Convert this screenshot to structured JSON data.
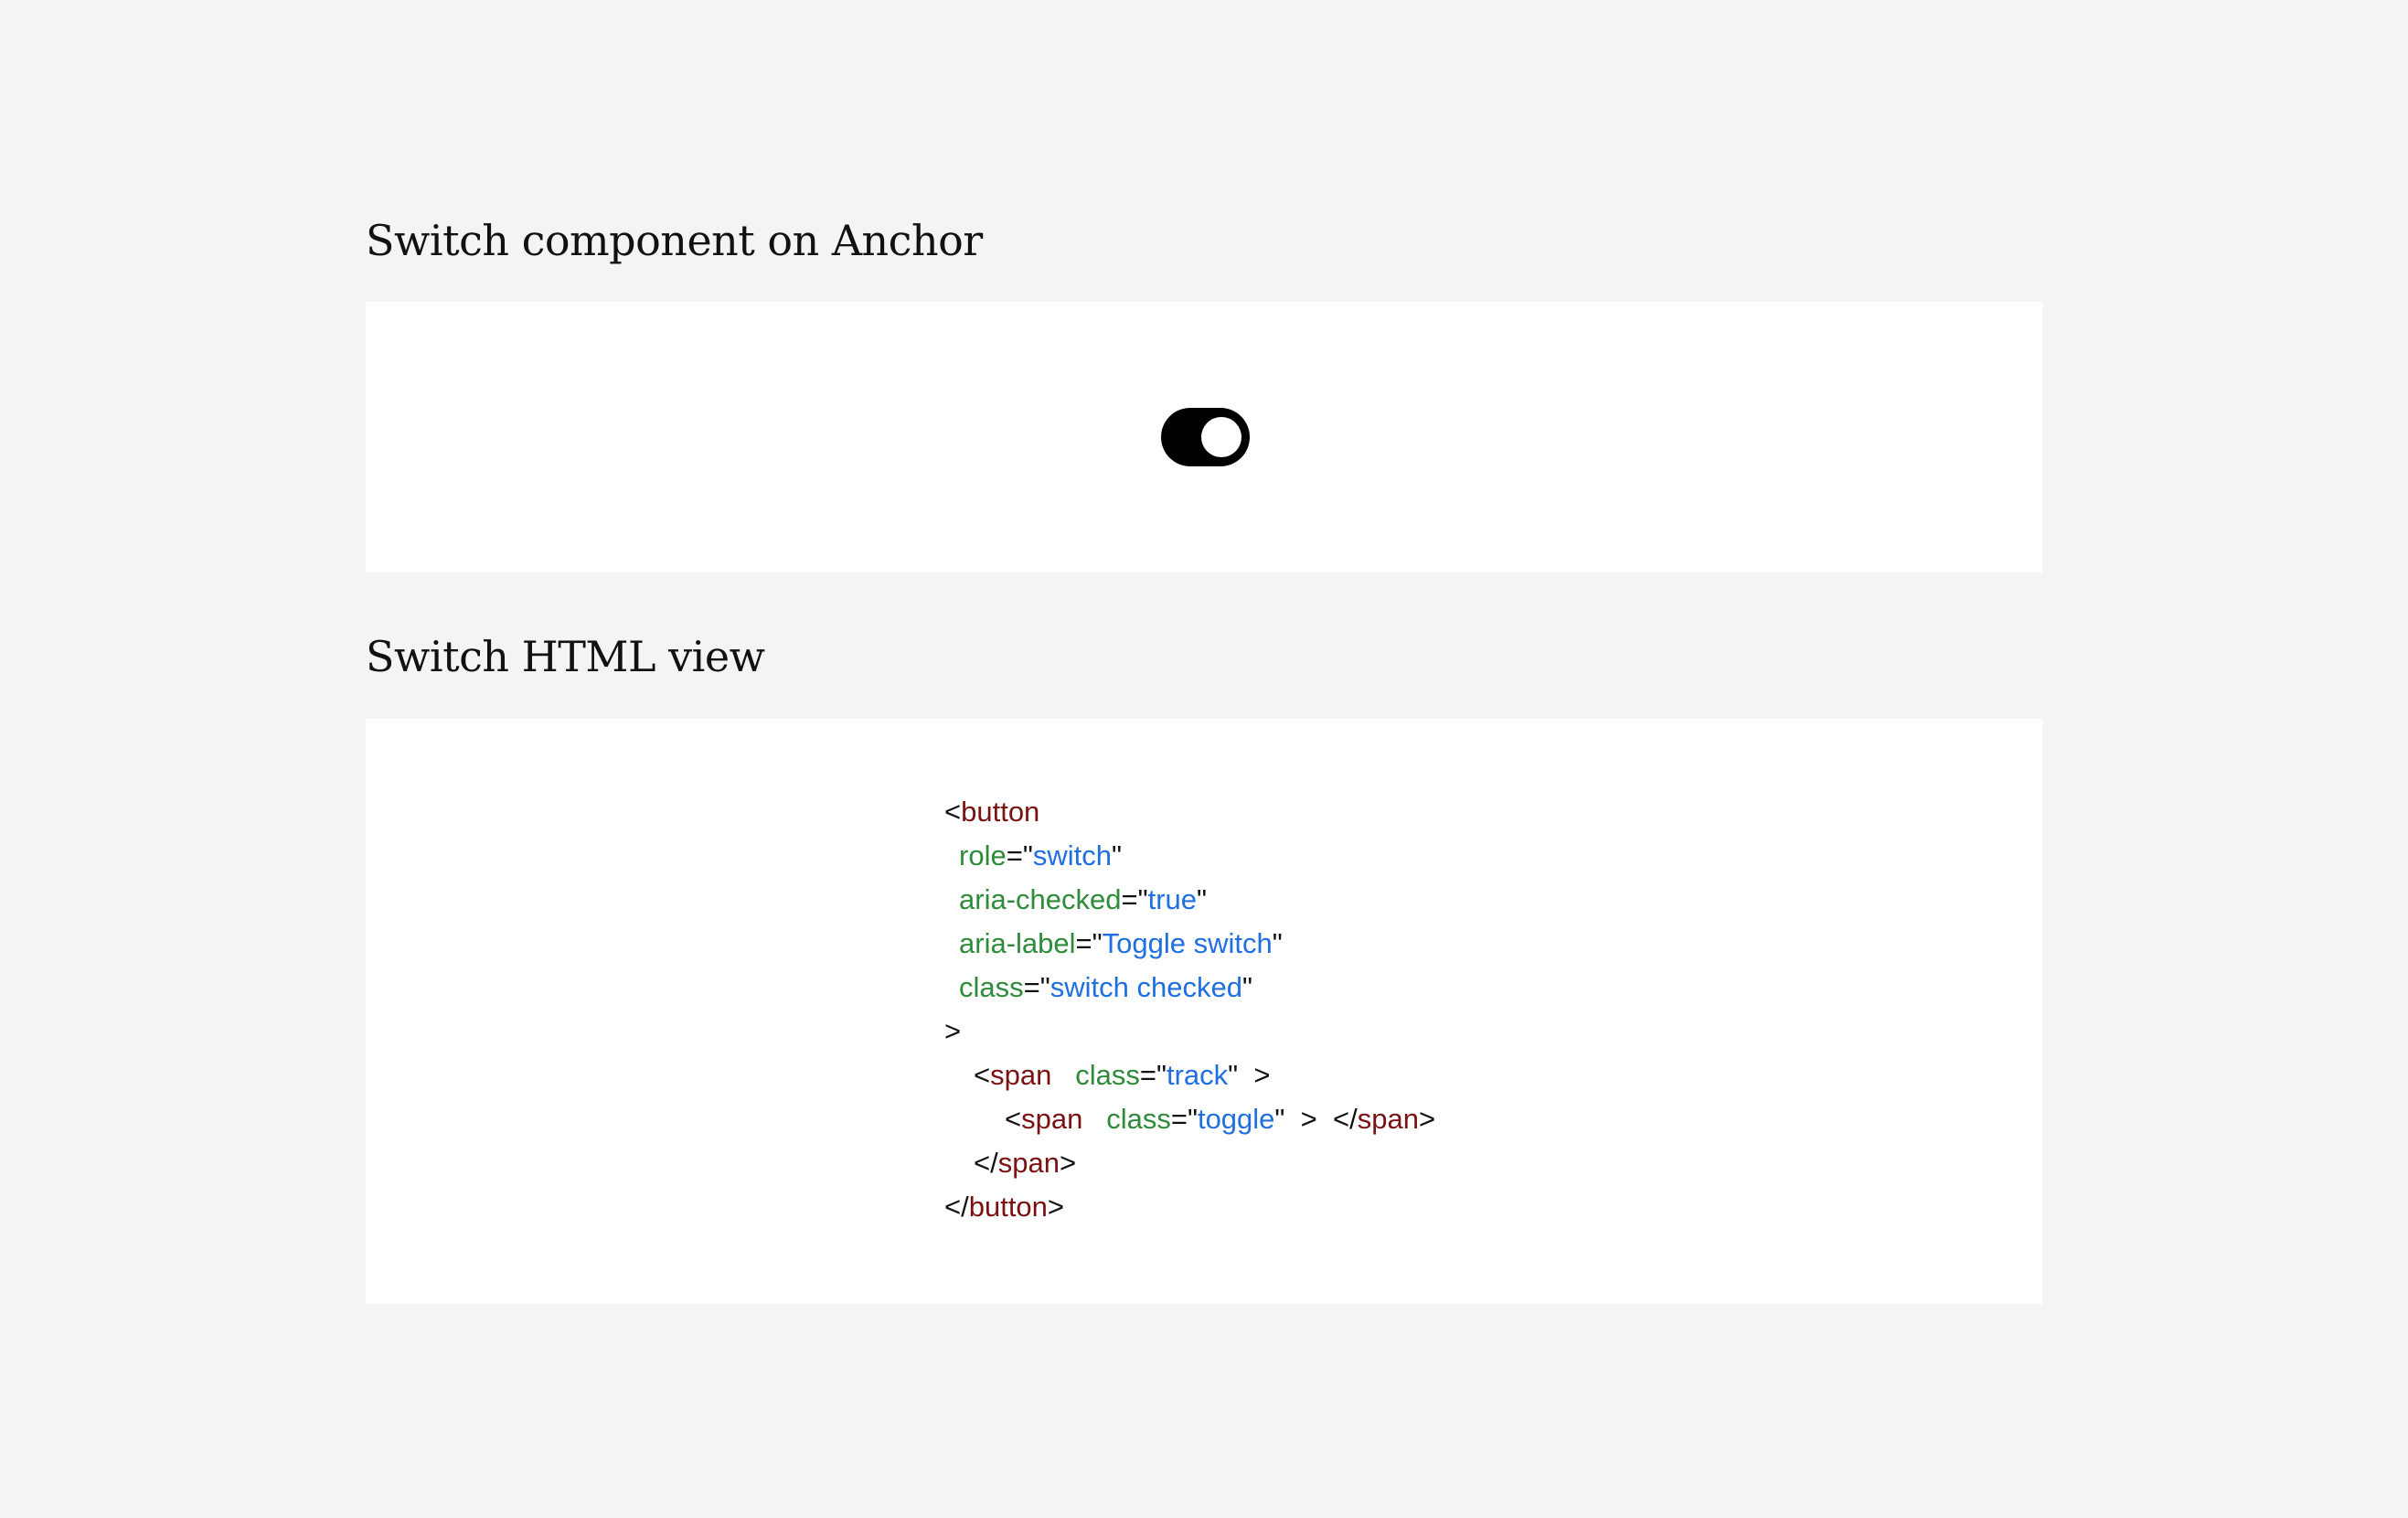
{
  "demo": {
    "heading": "Switch component on Anchor",
    "switch": {
      "checked": true,
      "aria_label": "Toggle switch",
      "track_color": "#000000",
      "toggle_color": "#ffffff"
    }
  },
  "code_view": {
    "heading": "Switch HTML view",
    "colors": {
      "tag": "#7a1212",
      "attribute": "#2e8b3a",
      "value": "#1f6fe0",
      "punctuation": "#111111"
    },
    "tokens": {
      "lt": "<",
      "gt": ">",
      "eq": "=",
      "quote": "\"",
      "close_open": "</",
      "button": "button",
      "span": "span",
      "role": "role",
      "switch": "switch",
      "aria_checked": "aria-checked",
      "true": "true",
      "aria_label": "aria-label",
      "toggle_switch": "Toggle switch",
      "class": "class",
      "switch_checked": "switch checked",
      "track": "track",
      "toggle": "toggle"
    }
  }
}
